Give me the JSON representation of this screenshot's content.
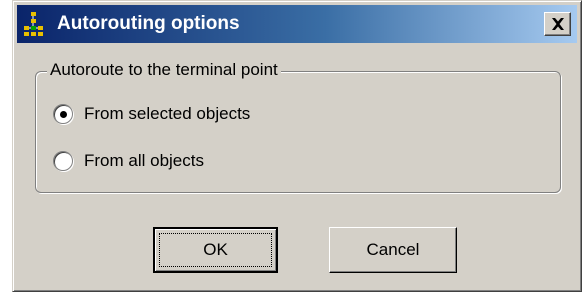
{
  "window": {
    "title": "Autorouting options",
    "icon": "autorouting-icon",
    "close_icon": "close-icon"
  },
  "group": {
    "title": "Autoroute to the terminal point",
    "options": [
      {
        "label": "From selected objects",
        "selected": true
      },
      {
        "label": "From all objects",
        "selected": false
      }
    ]
  },
  "buttons": {
    "ok_label": "OK",
    "cancel_label": "Cancel"
  },
  "colors": {
    "titlebar_start": "#0a246a",
    "titlebar_end": "#a6caf0",
    "face": "#d4d0c8"
  }
}
